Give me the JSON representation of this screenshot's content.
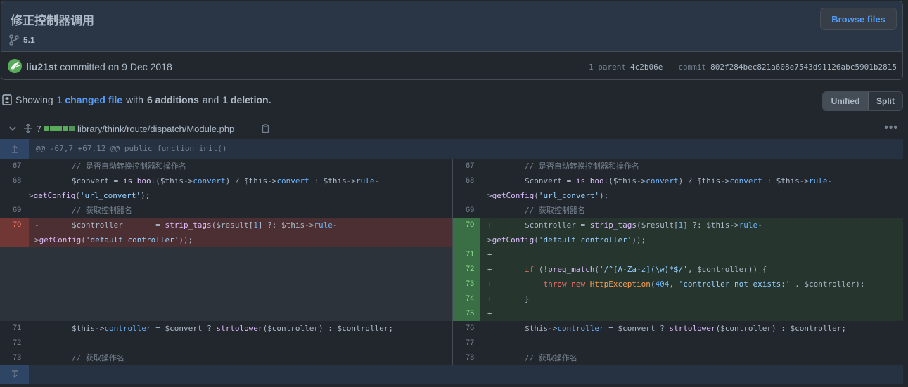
{
  "commit": {
    "title": "修正控制器调用",
    "branch": "5.1",
    "browse_label": "Browse files",
    "author": "liu21st",
    "committed_text": "committed on 9 Dec 2018",
    "parent_label": "1 parent",
    "parent_sha": "4c2b06e",
    "commit_label": "commit",
    "commit_sha": "802f284bec821a608e7543d91126abc5901b2815"
  },
  "summary": {
    "showing": "Showing",
    "changed": "1 changed file",
    "with": "with",
    "additions": "6 additions",
    "and": "and",
    "deletions": "1 deletion",
    "period": "."
  },
  "view_toggle": {
    "unified": "Unified",
    "split": "Split"
  },
  "file": {
    "change_count": "7",
    "path": "library/think/route/dispatch/Module.php"
  },
  "hunk": "@@ -67,7 +67,12 @@ public function init()",
  "left_lines": [
    "67",
    "68",
    "69",
    "70",
    "71",
    "72",
    "73"
  ],
  "right_lines": [
    "67",
    "68",
    "69",
    "70",
    "71",
    "72",
    "73",
    "74",
    "75",
    "76",
    "77",
    "78"
  ],
  "colors": {
    "accent": "#539bf5",
    "added": "#57ab5a",
    "deleted": "#f47067"
  },
  "icons": [
    "branch-icon",
    "diff-icon",
    "chevron-down-icon",
    "expand-icon",
    "copy-icon",
    "kebab-icon",
    "expand-up-icon",
    "expand-down-icon"
  ]
}
